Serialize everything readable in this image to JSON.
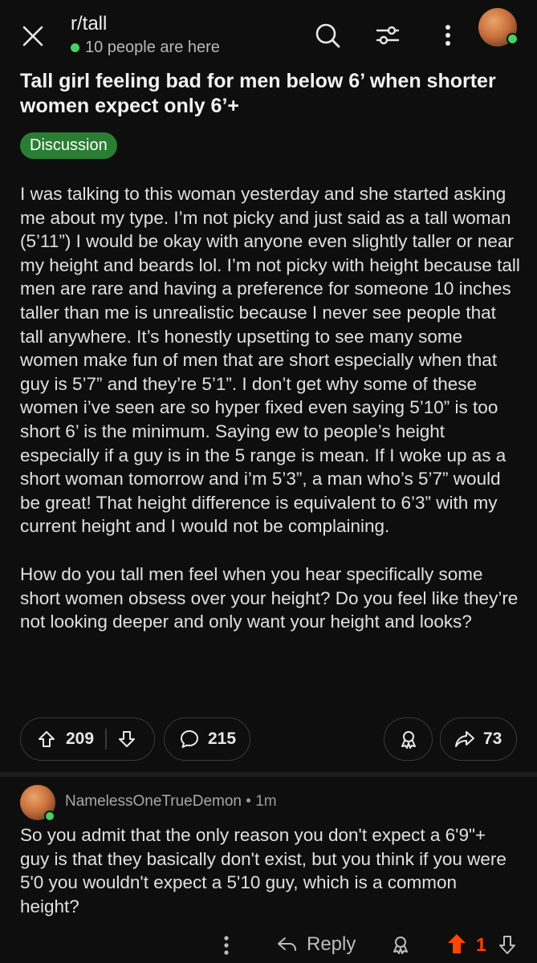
{
  "header": {
    "subreddit": "r/tall",
    "online_text": "10 people are here",
    "icons": [
      "close-icon",
      "search-icon",
      "filter-icon",
      "more-vertical-icon",
      "avatar"
    ]
  },
  "post": {
    "title": "Tall girl feeling bad for men below 6’ when shorter women expect only 6’+",
    "flair": "Discussion",
    "paragraphs": [
      "I was talking to this woman yesterday and she started asking me about my type. I’m not picky and just said as a tall woman (5’11”) I would be okay with anyone even slightly taller or near my height and beards lol. I’m not picky with height because tall men are rare and having a preference for someone 10 inches taller than me is unrealistic because I never see people that tall anywhere. It’s honestly upsetting to see many some women make fun of men that are short especially when that guy is 5’7” and they’re 5’1”. I don’t get why some of these women i’ve seen are so hyper fixed even saying 5’10” is too short 6’ is the minimum. Saying ew to people’s height especially if a guy is in the 5 range is mean. If I woke up as a short woman tomorrow and i’m 5’3”, a man who’s 5’7” would be great! That height difference is equivalent to 6’3” with my current height and I would not be complaining.",
      "How do you tall men feel when you hear specifically some short women obsess over your height? Do you feel like they’re not looking deeper and only want your height and looks?"
    ],
    "upvotes": "209",
    "comments": "215",
    "shares": "73"
  },
  "comment": {
    "author": "NamelessOneTrueDemon",
    "separator": "•",
    "time": "1m",
    "text": "So you admit that the only reason you don't expect a 6'9\"+ guy is that they basically don't exist, but you think if you were 5'0 you wouldn't expect a 5'10 guy, which is a common height?",
    "reply_label": "Reply",
    "score": "1"
  },
  "colors": {
    "background": "#0e0e0e",
    "flair": "#2a7e33",
    "online": "#46d160",
    "upvote_active": "#ff4500"
  }
}
